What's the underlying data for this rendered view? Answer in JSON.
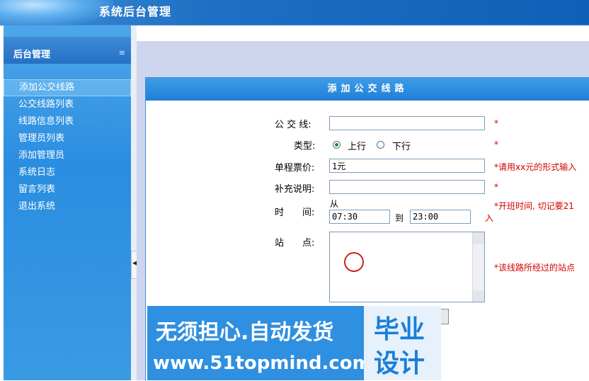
{
  "app": {
    "title": "系统后台管理"
  },
  "sidebar": {
    "heading": "后台管理",
    "items": [
      {
        "label": "添加公交线路",
        "active": true
      },
      {
        "label": "公交线路列表"
      },
      {
        "label": "线路信息列表"
      },
      {
        "label": "管理员列表"
      },
      {
        "label": "添加管理员"
      },
      {
        "label": "系统日志"
      },
      {
        "label": "留言列表"
      },
      {
        "label": "退出系统"
      }
    ]
  },
  "form": {
    "title": "添加公交线路",
    "line": {
      "label": "公 交 线:",
      "value": "",
      "hint": "*"
    },
    "type": {
      "label": "类型:",
      "options": [
        "上行",
        "下行"
      ],
      "selected": "上行",
      "hint": "*"
    },
    "fare": {
      "label": "单程票价:",
      "value": "1元",
      "hint": "*请用xx元的形式输入"
    },
    "note": {
      "label": "补充说明:",
      "value": "",
      "hint": "*"
    },
    "time": {
      "label": "时　　间:",
      "from_label": "从",
      "to_label": "到",
      "start": "07:30",
      "end": "23:00",
      "hint": "*开班时间, 切记要21",
      "hint_cont": "入"
    },
    "stations": {
      "label": "站　　点:",
      "value": "",
      "hint": "*该线路所经过的站点"
    }
  },
  "watermark": {
    "line1": "无须担心.自动发货",
    "line2": "www.51topmind.com",
    "badge_top": "毕业",
    "badge_bottom": "设计"
  },
  "colors": {
    "accent": "#1f7fd6",
    "required": "#d40000",
    "sidebar": "#2a8de0"
  }
}
